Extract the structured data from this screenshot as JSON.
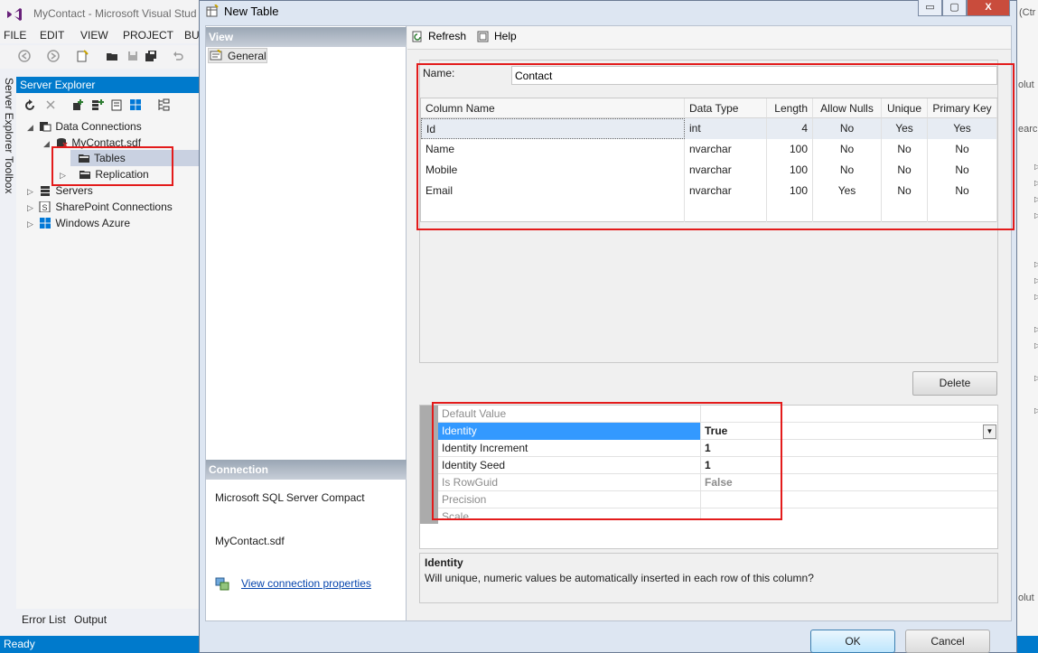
{
  "vs": {
    "title": "MyContact - Microsoft Visual Stud",
    "menu": [
      "FILE",
      "EDIT",
      "VIEW",
      "PROJECT",
      "BU"
    ],
    "side_tabs": [
      "Server Explorer",
      "Toolbox"
    ],
    "server_explorer": {
      "header": "Server Explorer",
      "tree": {
        "data_connections": "Data Connections",
        "db": "MyContact.sdf",
        "tables": "Tables",
        "replication": "Replication",
        "servers": "Servers",
        "sharepoint": "SharePoint Connections",
        "azure": "Windows Azure"
      }
    },
    "bottom_tabs": [
      "Error List",
      "Output"
    ],
    "status": "Ready",
    "right_fragments": [
      "(Ctr",
      "olut",
      "earc",
      "olut"
    ]
  },
  "dialog": {
    "title": "New Table",
    "controls": {
      "minimize": "▭",
      "maximize": "▢",
      "close": "X"
    },
    "view_header": "View",
    "general_item": "General",
    "connection_header": "Connection",
    "connection_provider": "Microsoft SQL Server Compact",
    "connection_file": "MyContact.sdf",
    "view_connection_link": "View connection properties",
    "toolbar": {
      "refresh": "Refresh",
      "help": "Help"
    },
    "name_label": "Name:",
    "name_value": "Contact",
    "grid": {
      "headers": [
        "Column Name",
        "Data Type",
        "Length",
        "Allow Nulls",
        "Unique",
        "Primary Key"
      ],
      "rows": [
        [
          "Id",
          "int",
          "4",
          "No",
          "Yes",
          "Yes"
        ],
        [
          "Name",
          "nvarchar",
          "100",
          "No",
          "No",
          "No"
        ],
        [
          "Mobile",
          "nvarchar",
          "100",
          "No",
          "No",
          "No"
        ],
        [
          "Email",
          "nvarchar",
          "100",
          "Yes",
          "No",
          "No"
        ]
      ]
    },
    "delete_label": "Delete",
    "properties": [
      {
        "name": "Default Value",
        "value": ""
      },
      {
        "name": "Identity",
        "value": "True"
      },
      {
        "name": "Identity Increment",
        "value": "1"
      },
      {
        "name": "Identity Seed",
        "value": "1"
      },
      {
        "name": "Is RowGuid",
        "value": "False"
      },
      {
        "name": "Precision",
        "value": ""
      },
      {
        "name": "Scale",
        "value": ""
      }
    ],
    "description": {
      "title": "Identity",
      "text": "Will unique, numeric values be automatically inserted in each row of this column?"
    },
    "ok_label": "OK",
    "cancel_label": "Cancel"
  },
  "colors": {
    "vs_accent": "#007acc",
    "selection": "#3399ff",
    "annotation_red": "#e31b1b"
  }
}
